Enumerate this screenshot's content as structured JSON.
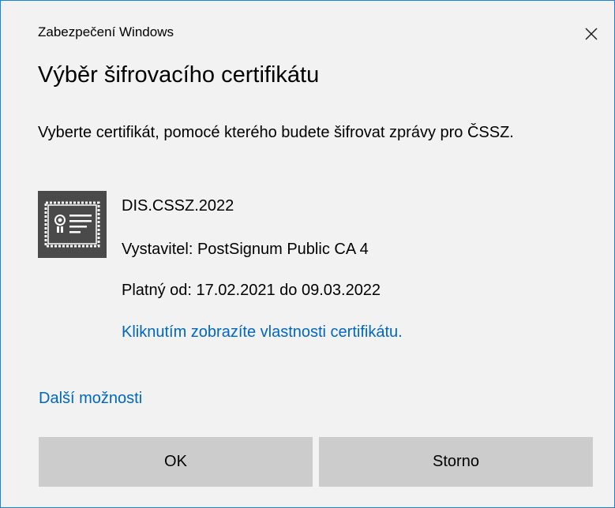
{
  "window": {
    "caption": "Zabezpečení Windows",
    "close_icon": "close-icon"
  },
  "dialog": {
    "title": "Výběr šifrovacího certifikátu",
    "instruction": "Vyberte certifikát, pomocé kterého budete šifrovat zprávy pro ČSSZ."
  },
  "certificate": {
    "icon": "certificate-icon",
    "name": "DIS.CSSZ.2022",
    "issuer": "Vystavitel: PostSignum Public CA 4",
    "validity": "Platný od: 17.02.2021 do 09.03.2022",
    "properties_link": "Kliknutím zobrazíte vlastnosti certifikátu."
  },
  "more_options": "Další možnosti",
  "buttons": {
    "ok": "OK",
    "cancel": "Storno"
  },
  "colors": {
    "accent_border": "#1883d7",
    "link": "#0067c0",
    "button": "#cccccc",
    "background": "#f2f2f2",
    "icon_bg": "#4a4a4a"
  }
}
